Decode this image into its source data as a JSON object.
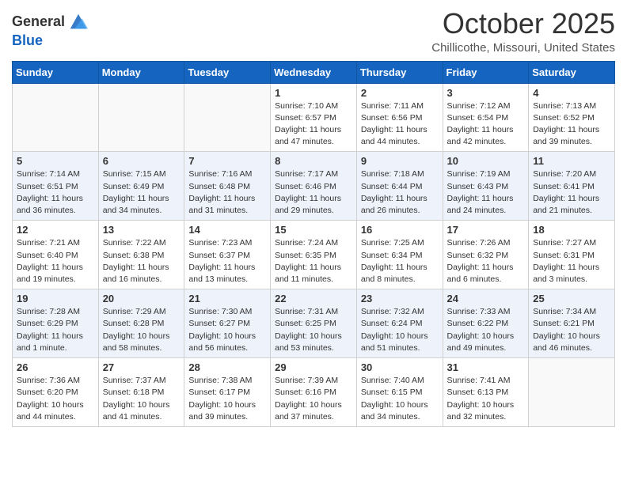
{
  "header": {
    "logo_general": "General",
    "logo_blue": "Blue",
    "month_title": "October 2025",
    "location": "Chillicothe, Missouri, United States"
  },
  "weekdays": [
    "Sunday",
    "Monday",
    "Tuesday",
    "Wednesday",
    "Thursday",
    "Friday",
    "Saturday"
  ],
  "weeks": [
    [
      {
        "day": "",
        "sunrise": "",
        "sunset": "",
        "daylight": ""
      },
      {
        "day": "",
        "sunrise": "",
        "sunset": "",
        "daylight": ""
      },
      {
        "day": "",
        "sunrise": "",
        "sunset": "",
        "daylight": ""
      },
      {
        "day": "1",
        "sunrise": "Sunrise: 7:10 AM",
        "sunset": "Sunset: 6:57 PM",
        "daylight": "Daylight: 11 hours and 47 minutes."
      },
      {
        "day": "2",
        "sunrise": "Sunrise: 7:11 AM",
        "sunset": "Sunset: 6:56 PM",
        "daylight": "Daylight: 11 hours and 44 minutes."
      },
      {
        "day": "3",
        "sunrise": "Sunrise: 7:12 AM",
        "sunset": "Sunset: 6:54 PM",
        "daylight": "Daylight: 11 hours and 42 minutes."
      },
      {
        "day": "4",
        "sunrise": "Sunrise: 7:13 AM",
        "sunset": "Sunset: 6:52 PM",
        "daylight": "Daylight: 11 hours and 39 minutes."
      }
    ],
    [
      {
        "day": "5",
        "sunrise": "Sunrise: 7:14 AM",
        "sunset": "Sunset: 6:51 PM",
        "daylight": "Daylight: 11 hours and 36 minutes."
      },
      {
        "day": "6",
        "sunrise": "Sunrise: 7:15 AM",
        "sunset": "Sunset: 6:49 PM",
        "daylight": "Daylight: 11 hours and 34 minutes."
      },
      {
        "day": "7",
        "sunrise": "Sunrise: 7:16 AM",
        "sunset": "Sunset: 6:48 PM",
        "daylight": "Daylight: 11 hours and 31 minutes."
      },
      {
        "day": "8",
        "sunrise": "Sunrise: 7:17 AM",
        "sunset": "Sunset: 6:46 PM",
        "daylight": "Daylight: 11 hours and 29 minutes."
      },
      {
        "day": "9",
        "sunrise": "Sunrise: 7:18 AM",
        "sunset": "Sunset: 6:44 PM",
        "daylight": "Daylight: 11 hours and 26 minutes."
      },
      {
        "day": "10",
        "sunrise": "Sunrise: 7:19 AM",
        "sunset": "Sunset: 6:43 PM",
        "daylight": "Daylight: 11 hours and 24 minutes."
      },
      {
        "day": "11",
        "sunrise": "Sunrise: 7:20 AM",
        "sunset": "Sunset: 6:41 PM",
        "daylight": "Daylight: 11 hours and 21 minutes."
      }
    ],
    [
      {
        "day": "12",
        "sunrise": "Sunrise: 7:21 AM",
        "sunset": "Sunset: 6:40 PM",
        "daylight": "Daylight: 11 hours and 19 minutes."
      },
      {
        "day": "13",
        "sunrise": "Sunrise: 7:22 AM",
        "sunset": "Sunset: 6:38 PM",
        "daylight": "Daylight: 11 hours and 16 minutes."
      },
      {
        "day": "14",
        "sunrise": "Sunrise: 7:23 AM",
        "sunset": "Sunset: 6:37 PM",
        "daylight": "Daylight: 11 hours and 13 minutes."
      },
      {
        "day": "15",
        "sunrise": "Sunrise: 7:24 AM",
        "sunset": "Sunset: 6:35 PM",
        "daylight": "Daylight: 11 hours and 11 minutes."
      },
      {
        "day": "16",
        "sunrise": "Sunrise: 7:25 AM",
        "sunset": "Sunset: 6:34 PM",
        "daylight": "Daylight: 11 hours and 8 minutes."
      },
      {
        "day": "17",
        "sunrise": "Sunrise: 7:26 AM",
        "sunset": "Sunset: 6:32 PM",
        "daylight": "Daylight: 11 hours and 6 minutes."
      },
      {
        "day": "18",
        "sunrise": "Sunrise: 7:27 AM",
        "sunset": "Sunset: 6:31 PM",
        "daylight": "Daylight: 11 hours and 3 minutes."
      }
    ],
    [
      {
        "day": "19",
        "sunrise": "Sunrise: 7:28 AM",
        "sunset": "Sunset: 6:29 PM",
        "daylight": "Daylight: 11 hours and 1 minute."
      },
      {
        "day": "20",
        "sunrise": "Sunrise: 7:29 AM",
        "sunset": "Sunset: 6:28 PM",
        "daylight": "Daylight: 10 hours and 58 minutes."
      },
      {
        "day": "21",
        "sunrise": "Sunrise: 7:30 AM",
        "sunset": "Sunset: 6:27 PM",
        "daylight": "Daylight: 10 hours and 56 minutes."
      },
      {
        "day": "22",
        "sunrise": "Sunrise: 7:31 AM",
        "sunset": "Sunset: 6:25 PM",
        "daylight": "Daylight: 10 hours and 53 minutes."
      },
      {
        "day": "23",
        "sunrise": "Sunrise: 7:32 AM",
        "sunset": "Sunset: 6:24 PM",
        "daylight": "Daylight: 10 hours and 51 minutes."
      },
      {
        "day": "24",
        "sunrise": "Sunrise: 7:33 AM",
        "sunset": "Sunset: 6:22 PM",
        "daylight": "Daylight: 10 hours and 49 minutes."
      },
      {
        "day": "25",
        "sunrise": "Sunrise: 7:34 AM",
        "sunset": "Sunset: 6:21 PM",
        "daylight": "Daylight: 10 hours and 46 minutes."
      }
    ],
    [
      {
        "day": "26",
        "sunrise": "Sunrise: 7:36 AM",
        "sunset": "Sunset: 6:20 PM",
        "daylight": "Daylight: 10 hours and 44 minutes."
      },
      {
        "day": "27",
        "sunrise": "Sunrise: 7:37 AM",
        "sunset": "Sunset: 6:18 PM",
        "daylight": "Daylight: 10 hours and 41 minutes."
      },
      {
        "day": "28",
        "sunrise": "Sunrise: 7:38 AM",
        "sunset": "Sunset: 6:17 PM",
        "daylight": "Daylight: 10 hours and 39 minutes."
      },
      {
        "day": "29",
        "sunrise": "Sunrise: 7:39 AM",
        "sunset": "Sunset: 6:16 PM",
        "daylight": "Daylight: 10 hours and 37 minutes."
      },
      {
        "day": "30",
        "sunrise": "Sunrise: 7:40 AM",
        "sunset": "Sunset: 6:15 PM",
        "daylight": "Daylight: 10 hours and 34 minutes."
      },
      {
        "day": "31",
        "sunrise": "Sunrise: 7:41 AM",
        "sunset": "Sunset: 6:13 PM",
        "daylight": "Daylight: 10 hours and 32 minutes."
      },
      {
        "day": "",
        "sunrise": "",
        "sunset": "",
        "daylight": ""
      }
    ]
  ]
}
